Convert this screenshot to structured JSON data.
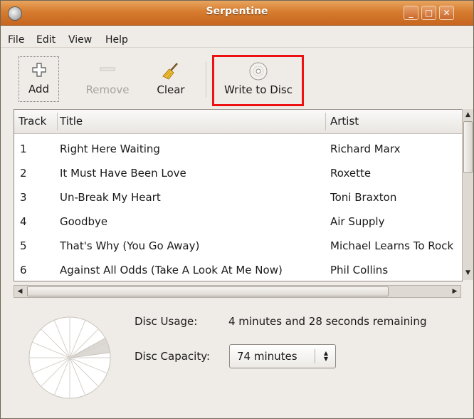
{
  "window": {
    "title": "Serpentine"
  },
  "menubar": {
    "items": [
      "File",
      "Edit",
      "View",
      "Help"
    ]
  },
  "toolbar": {
    "add_label": "Add",
    "remove_label": "Remove",
    "clear_label": "Clear",
    "write_label": "Write to Disc"
  },
  "tracklist": {
    "columns": [
      "Track",
      "Title",
      "Artist"
    ],
    "rows": [
      {
        "track": "1",
        "title": "Right Here Waiting",
        "artist": "Richard Marx"
      },
      {
        "track": "2",
        "title": "It Must Have Been Love",
        "artist": "Roxette"
      },
      {
        "track": "3",
        "title": "Un-Break My Heart",
        "artist": "Toni Braxton"
      },
      {
        "track": "4",
        "title": "Goodbye",
        "artist": "Air Supply"
      },
      {
        "track": "5",
        "title": "That's Why (You Go Away)",
        "artist": "Michael Learns To Rock"
      },
      {
        "track": "6",
        "title": "Against All Odds (Take A Look At Me Now)",
        "artist": "Phil Collins"
      }
    ]
  },
  "disc": {
    "usage_label": "Disc Usage:",
    "usage_value": "4 minutes and 28 seconds remaining",
    "capacity_label": "Disc Capacity:",
    "capacity_value": "74 minutes",
    "used_fraction": 0.06
  },
  "icons": {
    "add": "plus-icon",
    "remove": "minus-icon",
    "clear": "broom-icon",
    "write": "disc-icon"
  },
  "colors": {
    "titlebar": "#d67c2f",
    "highlight": "#ee1111"
  }
}
